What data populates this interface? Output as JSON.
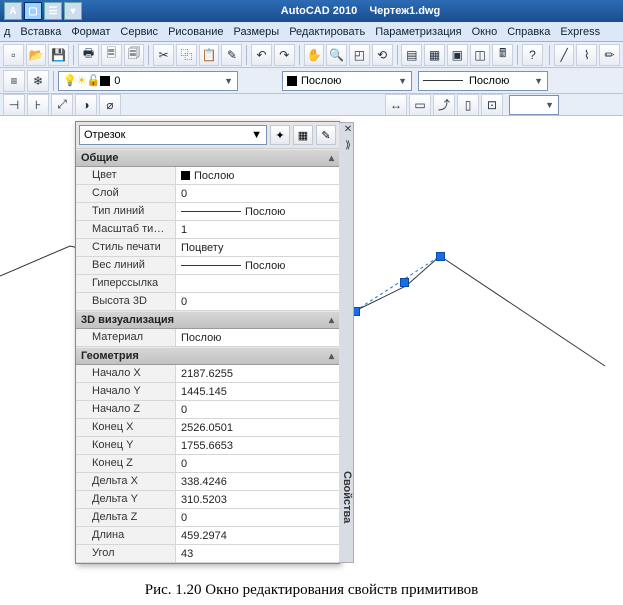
{
  "app": {
    "name": "AutoCAD 2010",
    "file": "Чертеж1.dwg"
  },
  "menu": [
    "д",
    "Вставка",
    "Формат",
    "Сервис",
    "Рисование",
    "Размеры",
    "Редактировать",
    "Параметризация",
    "Окно",
    "Справка",
    "Express"
  ],
  "layercombo": {
    "value": "0"
  },
  "propscombo": {
    "color": "Послою",
    "lt": "Послою"
  },
  "palette": {
    "selector": "Отрезок",
    "sections": {
      "general": {
        "title": "Общие",
        "rows": {
          "color": {
            "label": "Цвет",
            "value": "Послою"
          },
          "layer": {
            "label": "Слой",
            "value": "0"
          },
          "linetype": {
            "label": "Тип линий",
            "value": "Послою"
          },
          "ltscale": {
            "label": "Масштаб типа ли...",
            "value": "1"
          },
          "plotstyle": {
            "label": "Стиль печати",
            "value": "Поцвету"
          },
          "lweight": {
            "label": "Вес линий",
            "value": "Послою"
          },
          "hyperlink": {
            "label": "Гиперссылка",
            "value": ""
          },
          "thickness": {
            "label": "Высота 3D",
            "value": "0"
          }
        }
      },
      "viz3d": {
        "title": "3D визуализация",
        "rows": {
          "material": {
            "label": "Материал",
            "value": "Послою"
          }
        }
      },
      "geometry": {
        "title": "Геометрия",
        "rows": {
          "startx": {
            "label": "Начало X",
            "value": "2187.6255"
          },
          "starty": {
            "label": "Начало Y",
            "value": "1445.145"
          },
          "startz": {
            "label": "Начало Z",
            "value": "0"
          },
          "endx": {
            "label": "Конец X",
            "value": "2526.0501"
          },
          "endy": {
            "label": "Конец Y",
            "value": "1755.6653"
          },
          "endz": {
            "label": "Конец Z",
            "value": "0"
          },
          "deltax": {
            "label": "Дельта X",
            "value": "338.4246"
          },
          "deltay": {
            "label": "Дельта Y",
            "value": "310.5203"
          },
          "deltaz": {
            "label": "Дельта Z",
            "value": "0"
          },
          "length": {
            "label": "Длина",
            "value": "459.2974"
          },
          "angle": {
            "label": "Угол",
            "value": "43"
          }
        }
      }
    },
    "sidelabel": "Свойства"
  },
  "caption": "Рис. 1.20 Окно редактирования свойств примитивов"
}
